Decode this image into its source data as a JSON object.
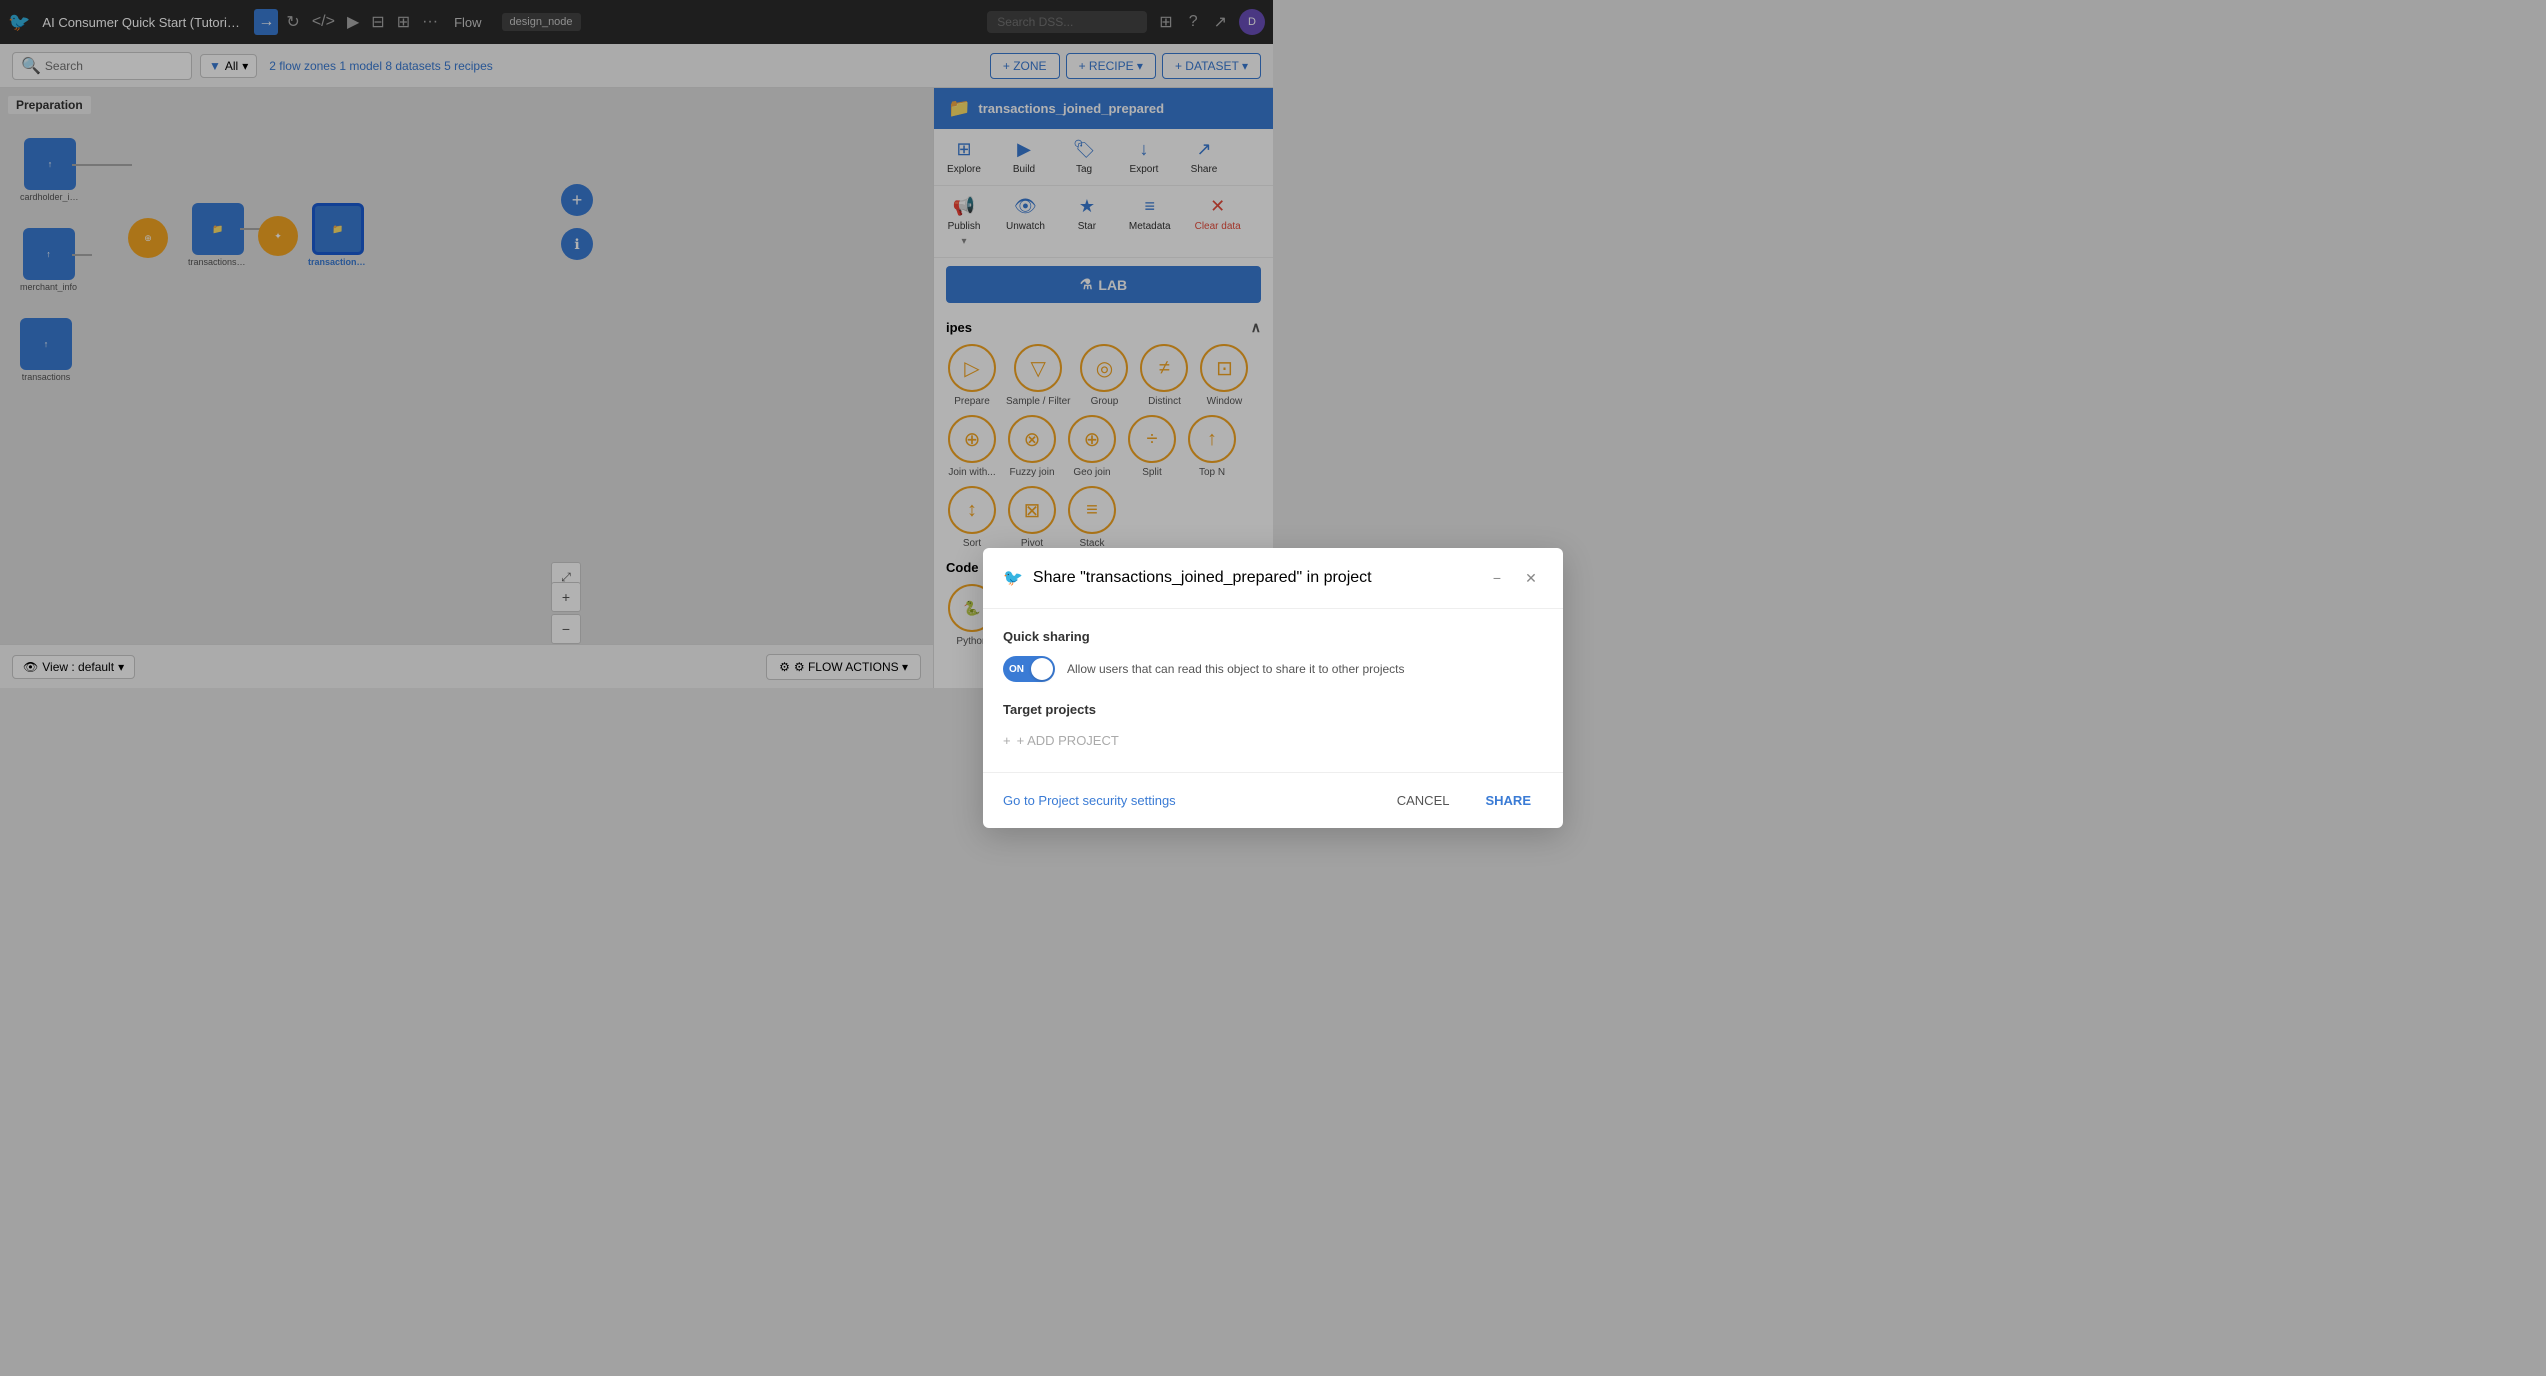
{
  "topNav": {
    "logoIcon": "🐦",
    "projectTitle": "AI Consumer Quick Start (Tutorial) for deni...",
    "navIcons": [
      "→",
      "↻",
      "</>",
      "▶",
      "⊟",
      "⊞",
      "···"
    ],
    "flowLabel": "Flow",
    "designNodeBadge": "design_node",
    "searchPlaceholder": "Search DSS...",
    "avatarLabel": "D"
  },
  "flowToolbar": {
    "searchPlaceholder": "Search",
    "filterLabel": "All",
    "statsPrefix": "2",
    "stats": [
      {
        "count": "2",
        "label": "flow zones"
      },
      {
        "count": "1",
        "label": "model"
      },
      {
        "count": "8",
        "label": "datasets"
      },
      {
        "count": "5",
        "label": "recipes"
      }
    ],
    "zoneBtn": "+ ZONE",
    "recipeBtn": "+ RECIPE ▾",
    "datasetBtn": "+ DATASET ▾"
  },
  "canvas": {
    "preparationLabel": "Preparation",
    "nodes": [
      {
        "id": "cardholder_info",
        "type": "blue",
        "icon": "↑",
        "label": "cardholder_info"
      },
      {
        "id": "merchant_info",
        "type": "blue",
        "icon": "↑",
        "label": "merchant_info"
      },
      {
        "id": "transactions",
        "type": "blue",
        "icon": "↑",
        "label": "transactions"
      },
      {
        "id": "join_node",
        "type": "yellow",
        "icon": "⊕",
        "label": ""
      },
      {
        "id": "transactions_joined",
        "type": "blue",
        "icon": "📁",
        "label": "transactions_joined"
      },
      {
        "id": "prepare_node",
        "type": "yellow",
        "icon": "✦",
        "label": ""
      },
      {
        "id": "transactions_prepared",
        "type": "blue",
        "icon": "📁",
        "label": "transactions_joined_prepared"
      }
    ],
    "viewDefault": "View : default",
    "flowActionsBtn": "⚙ FLOW ACTIONS ▾",
    "expandIcon": "⤢",
    "zoomIn": "+",
    "zoomOut": "−"
  },
  "rightPanel": {
    "title": "transactions_joined_prepared",
    "folderIcon": "📁",
    "actions": [
      {
        "id": "explore",
        "icon": "⊞",
        "label": "Explore"
      },
      {
        "id": "build",
        "icon": "▶",
        "label": "Build"
      },
      {
        "id": "tag",
        "icon": "🏷",
        "label": "Tag"
      },
      {
        "id": "export",
        "icon": "↓",
        "label": "Export"
      },
      {
        "id": "share",
        "icon": "↗",
        "label": "Share"
      },
      {
        "id": "publish",
        "icon": "📢",
        "label": "Publish"
      },
      {
        "id": "unwatch",
        "icon": "👁",
        "label": "Unwatch"
      },
      {
        "id": "star",
        "icon": "★",
        "label": "Star"
      },
      {
        "id": "metadata",
        "icon": "≡",
        "label": "Metadata"
      },
      {
        "id": "cleardata",
        "icon": "✕",
        "label": "Clear data"
      }
    ],
    "labLabel": "LAB",
    "recipesSection": {
      "label": "ipes",
      "items": [
        {
          "id": "prepare",
          "icon": "▷",
          "label": "Prepare"
        },
        {
          "id": "sample-filter",
          "icon": "▽",
          "label": "Sample / Filter"
        },
        {
          "id": "group",
          "icon": "◎",
          "label": "Group"
        },
        {
          "id": "distinct",
          "icon": "≠",
          "label": "Distinct"
        },
        {
          "id": "window",
          "icon": "⊡",
          "label": "Window"
        },
        {
          "id": "join-with",
          "icon": "⊕",
          "label": "Join with..."
        },
        {
          "id": "fuzzy-join",
          "icon": "⊗",
          "label": "Fuzzy join"
        },
        {
          "id": "geo-join",
          "icon": "⊕",
          "label": "Geo join"
        },
        {
          "id": "split",
          "icon": "÷",
          "label": "Split"
        },
        {
          "id": "top-n",
          "icon": "↑",
          "label": "Top N"
        },
        {
          "id": "sort",
          "icon": "↕",
          "label": "Sort"
        },
        {
          "id": "pivot",
          "icon": "⊠",
          "label": "Pivot"
        },
        {
          "id": "stack",
          "icon": "≡",
          "label": "Stack"
        }
      ]
    },
    "codeRecipesLabel": "Code recipes"
  },
  "modal": {
    "logoIcon": "🐦",
    "title": "Share \"transactions_joined_prepared\" in project",
    "quickSharing": {
      "label": "Quick sharing",
      "toggleState": "ON",
      "description": "Allow users that can read this object to share it to other projects"
    },
    "targetProjects": {
      "label": "Target projects",
      "addProjectLabel": "+ ADD PROJECT"
    },
    "footer": {
      "settingsLink": "Go to Project security settings",
      "cancelBtn": "CANCEL",
      "shareBtn": "SHARE"
    }
  }
}
